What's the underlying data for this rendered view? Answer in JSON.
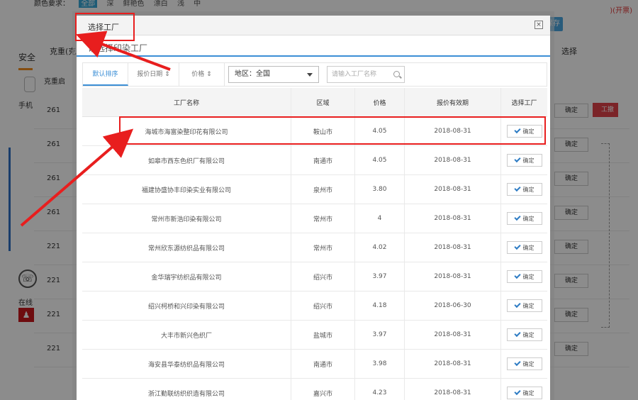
{
  "background": {
    "color_label": "颜色要求：",
    "color_options": [
      "全部",
      "深",
      "鲜艳色",
      "漂白",
      "浅",
      "中"
    ],
    "top_right_text": ")(开票)",
    "save_label": "保存",
    "weight_header": "克重(克/平",
    "select_header": "选择",
    "security_label": "安全",
    "start_label": "克重启",
    "phone_label": "手机",
    "online_label": "在线",
    "red_button_label": "工撤",
    "rows": [
      {
        "qty": "261",
        "select": "确定"
      },
      {
        "qty": "261",
        "select": "确定"
      },
      {
        "qty": "261",
        "select": "确定"
      },
      {
        "qty": "261",
        "select": "确定"
      },
      {
        "qty": "221",
        "select": "确定"
      },
      {
        "qty": "221",
        "select": "确定"
      },
      {
        "qty": "221",
        "select": "确定"
      },
      {
        "qty": "221",
        "select": "确定"
      }
    ]
  },
  "modal": {
    "title": "选择工厂",
    "subtitle": "请选择印染工厂",
    "filters": {
      "default_sort": "默认排序",
      "date_sort": "报价日期",
      "price_sort": "价格",
      "region_select": "地区：全国",
      "search_placeholder": "请输入工厂名称"
    },
    "table": {
      "headers": {
        "name": "工厂名称",
        "region": "区域",
        "price": "价格",
        "valid_until": "报价有效期",
        "select": "选择工厂"
      },
      "rows": [
        {
          "name": "海城市海富染整印花有限公司",
          "region": "鞍山市",
          "price": "4.05",
          "date": "2018-08-31",
          "action": "确定"
        },
        {
          "name": "如皋市西东色织厂有限公司",
          "region": "南通市",
          "price": "4.05",
          "date": "2018-08-31",
          "action": "确定"
        },
        {
          "name": "福建协盛协丰印染实业有限公司",
          "region": "泉州市",
          "price": "3.80",
          "date": "2018-08-31",
          "action": "确定"
        },
        {
          "name": "常州市新浩印染有限公司",
          "region": "常州市",
          "price": "4",
          "date": "2018-08-31",
          "action": "确定"
        },
        {
          "name": "常州欣东源纺织品有限公司",
          "region": "常州市",
          "price": "4.02",
          "date": "2018-08-31",
          "action": "确定"
        },
        {
          "name": "金华瑞宇纺织品有限公司",
          "region": "绍兴市",
          "price": "3.97",
          "date": "2018-08-31",
          "action": "确定"
        },
        {
          "name": "绍兴柯桥和兴印染有限公司",
          "region": "绍兴市",
          "price": "4.18",
          "date": "2018-06-30",
          "action": "确定"
        },
        {
          "name": "大丰市新兴色织厂",
          "region": "盐城市",
          "price": "3.97",
          "date": "2018-08-31",
          "action": "确定"
        },
        {
          "name": "海安县华泰纺织品有限公司",
          "region": "南通市",
          "price": "3.98",
          "date": "2018-08-31",
          "action": "确定"
        },
        {
          "name": "浙江勤联纺织织造有限公司",
          "region": "嘉兴市",
          "price": "4.23",
          "date": "2018-08-31",
          "action": "确定"
        }
      ]
    }
  },
  "annotation_color": "#e81e1e"
}
